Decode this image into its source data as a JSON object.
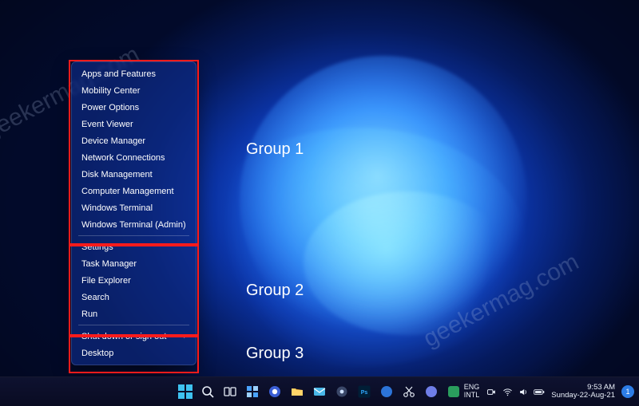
{
  "watermark": "geekermag.com",
  "annotations": {
    "g1": "Group 1",
    "g2": "Group 2",
    "g3": "Group 3"
  },
  "menu": {
    "group1": [
      "Apps and Features",
      "Mobility Center",
      "Power Options",
      "Event Viewer",
      "Device Manager",
      "Network Connections",
      "Disk Management",
      "Computer Management",
      "Windows Terminal",
      "Windows Terminal (Admin)"
    ],
    "group2": [
      "Settings",
      "Task Manager",
      "File Explorer",
      "Search",
      "Run"
    ],
    "group3_flyout": "Shut down or sign out",
    "group3_last": "Desktop"
  },
  "taskbar": {
    "chevron": "^",
    "lang_line1": "ENG",
    "lang_line2": "INTL",
    "time": "9:53 AM",
    "date": "Sunday-22-Aug-21",
    "notif_count": "1"
  }
}
